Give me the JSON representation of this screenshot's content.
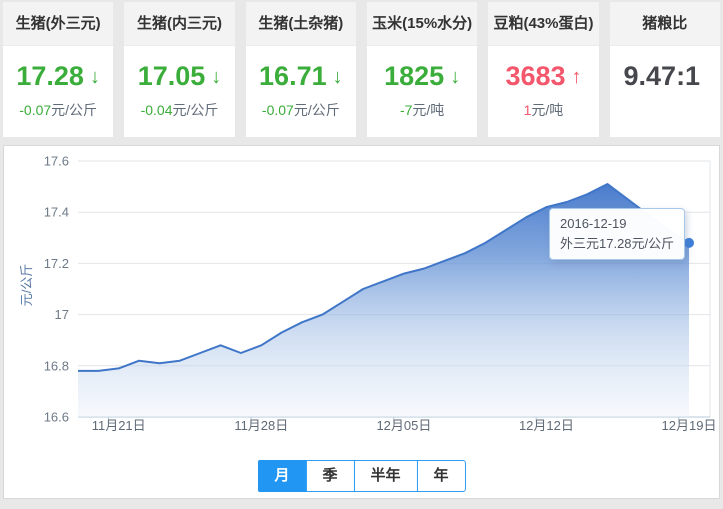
{
  "cards": {
    "items": [
      {
        "title": "生猪(外三元)",
        "value": "17.28",
        "arrow": "↓",
        "trend": "down",
        "change_value": "-0.07",
        "change_unit": "元/公斤"
      },
      {
        "title": "生猪(内三元)",
        "value": "17.05",
        "arrow": "↓",
        "trend": "down",
        "change_value": "-0.04",
        "change_unit": "元/公斤"
      },
      {
        "title": "生猪(土杂猪)",
        "value": "16.71",
        "arrow": "↓",
        "trend": "down",
        "change_value": "-0.07",
        "change_unit": "元/公斤"
      },
      {
        "title": "玉米(15%水分)",
        "value": "1825",
        "arrow": "↓",
        "trend": "down",
        "change_value": "-7",
        "change_unit": "元/吨"
      },
      {
        "title": "豆粕(43%蛋白)",
        "value": "3683",
        "arrow": "↑",
        "trend": "up",
        "change_value": "1",
        "change_unit": "元/吨"
      },
      {
        "title": "猪粮比",
        "value": "9.47:1",
        "arrow": "",
        "trend": "none",
        "change_value": "",
        "change_unit": ""
      }
    ]
  },
  "tooltip": {
    "line1": "2016-12-19",
    "line2": "外三元17.28元/公斤"
  },
  "tabs": {
    "items": [
      {
        "label": "月",
        "active": true
      },
      {
        "label": "季",
        "active": false
      },
      {
        "label": "半年",
        "active": false
      },
      {
        "label": "年",
        "active": false
      }
    ]
  },
  "colors": {
    "down_green": "#3aad3a",
    "up_red": "#f4566b",
    "neutral_dark": "#46474c",
    "accent_blue": "#2196f3",
    "tab_border_blue": "#2d9cf2",
    "line_blue": "#4076c8",
    "dot_blue": "#3e7fd8"
  },
  "chart_data": {
    "type": "area",
    "title": "",
    "xlabel": "",
    "ylabel": "元/公斤",
    "ylim": [
      16.6,
      17.6
    ],
    "grid": true,
    "legend": false,
    "y_ticks": [
      "17.6",
      "17.4",
      "17.2",
      "17",
      "16.8",
      "16.6"
    ],
    "x_tick_labels": [
      "11月21日",
      "11月28日",
      "12月05日",
      "12月12日",
      "12月19日"
    ],
    "x_tick_indices": [
      2,
      9,
      16,
      23,
      30
    ],
    "x": [
      "11月19日",
      "11月20日",
      "11月21日",
      "11月22日",
      "11月23日",
      "11月24日",
      "11月25日",
      "11月26日",
      "11月27日",
      "11月28日",
      "11月29日",
      "11月30日",
      "12月01日",
      "12月02日",
      "12月03日",
      "12月04日",
      "12月05日",
      "12月06日",
      "12月07日",
      "12月08日",
      "12月09日",
      "12月10日",
      "12月11日",
      "12月12日",
      "12月13日",
      "12月14日",
      "12月15日",
      "12月16日",
      "12月17日",
      "12月18日",
      "12月19日"
    ],
    "series": [
      {
        "name": "外三元",
        "values": [
          16.78,
          16.78,
          16.79,
          16.82,
          16.81,
          16.82,
          16.85,
          16.88,
          16.85,
          16.88,
          16.93,
          16.97,
          17.0,
          17.05,
          17.1,
          17.13,
          17.16,
          17.18,
          17.21,
          17.24,
          17.28,
          17.33,
          17.38,
          17.42,
          17.44,
          17.47,
          17.51,
          17.45,
          17.39,
          17.33,
          17.28
        ]
      }
    ]
  }
}
